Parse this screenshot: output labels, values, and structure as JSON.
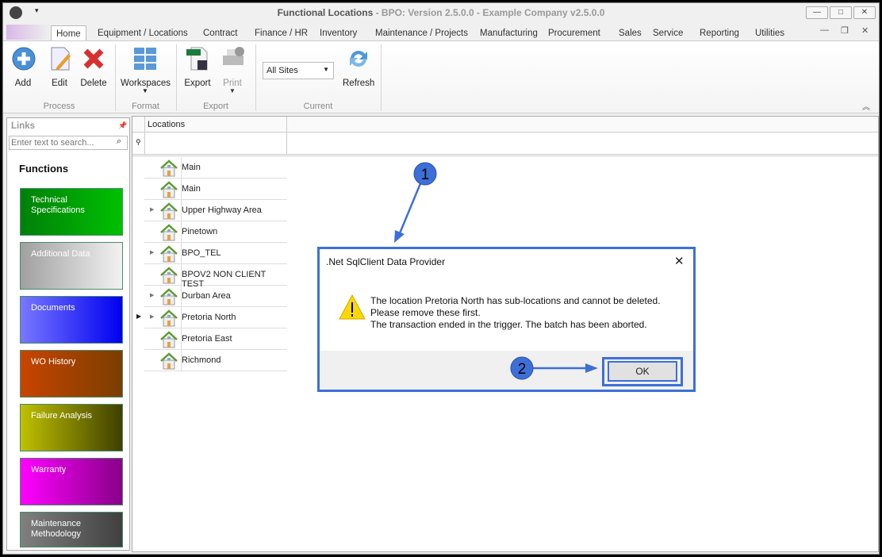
{
  "window": {
    "title": "Functional Locations",
    "subtitle": " - BPO: Version 2.5.0.0 - Example Company v2.5.0.0"
  },
  "tabs": [
    "Home",
    "Equipment / Locations",
    "Contract",
    "Finance / HR",
    "Inventory",
    "Maintenance / Projects",
    "Manufacturing",
    "Procurement",
    "Sales",
    "Service",
    "Reporting",
    "Utilities"
  ],
  "ribbon": {
    "add": "Add",
    "edit": "Edit",
    "delete": "Delete",
    "workspaces": "Workspaces",
    "export": "Export",
    "print": "Print",
    "site": "All Sites",
    "refresh": "Refresh",
    "groups": {
      "process": "Process",
      "format": "Format",
      "export": "Export",
      "current": "Current"
    }
  },
  "sidebar": {
    "title": "Links",
    "search_placeholder": "Enter text to search...",
    "heading": "Functions",
    "tiles": [
      {
        "label": "Technical Specifications",
        "from": "#00800a",
        "to": "#00c000"
      },
      {
        "label": "Additional Data",
        "from": "#a0a0a0",
        "to": "#f2f2f2"
      },
      {
        "label": "Documents",
        "from": "#7878ff",
        "to": "#0000f0"
      },
      {
        "label": "WO History",
        "from": "#c84400",
        "to": "#7a3e00"
      },
      {
        "label": "Failure Analysis",
        "from": "#c0c000",
        "to": "#3e4000"
      },
      {
        "label": "Warranty",
        "from": "#ff00ff",
        "to": "#880088"
      },
      {
        "label": "Maintenance Methodology",
        "from": "#808080",
        "to": "#404040"
      }
    ]
  },
  "grid": {
    "column": "Locations",
    "rows": [
      {
        "label": "Main",
        "expandable": false
      },
      {
        "label": "Main",
        "expandable": false
      },
      {
        "label": "Upper Highway Area",
        "expandable": true
      },
      {
        "label": "Pinetown",
        "expandable": false
      },
      {
        "label": "BPO_TEL",
        "expandable": true
      },
      {
        "label": "BPOV2 NON CLIENT TEST",
        "expandable": false
      },
      {
        "label": "Durban Area",
        "expandable": true
      },
      {
        "label": "Pretoria North",
        "expandable": true,
        "current": true
      },
      {
        "label": "Pretoria East",
        "expandable": false
      },
      {
        "label": "Richmond",
        "expandable": false
      }
    ]
  },
  "dialog": {
    "title": ".Net SqlClient Data Provider",
    "line1": "The location Pretoria North has sub-locations and cannot be deleted.",
    "line2": "Please remove these first.",
    "line3": "The transaction ended in the trigger. The batch has been aborted.",
    "ok": "OK"
  },
  "annotations": {
    "step1": "1",
    "step2": "2",
    "color": "#3d6fd8"
  }
}
